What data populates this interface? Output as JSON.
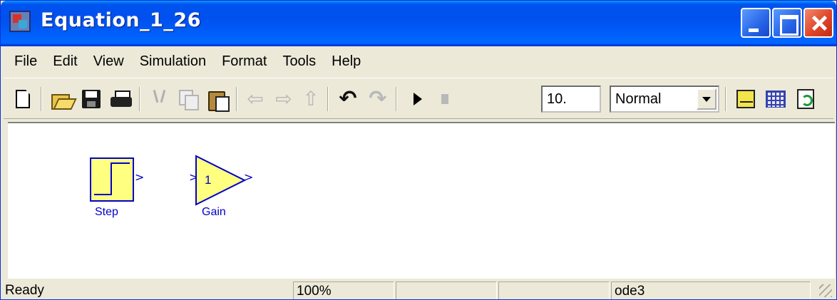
{
  "window": {
    "title": "Equation_1_26",
    "controls": [
      "minimize-icon",
      "maximize-icon",
      "close-icon"
    ]
  },
  "menu": {
    "items": [
      "File",
      "Edit",
      "View",
      "Simulation",
      "Format",
      "Tools",
      "Help"
    ]
  },
  "toolbar": {
    "icons": [
      "new-model-icon",
      "open-icon",
      "save-icon",
      "print-icon",
      "cut-icon",
      "copy-icon",
      "paste-icon",
      "back-icon",
      "forward-icon",
      "up-icon",
      "undo-icon",
      "redo-icon",
      "start-simulation-icon",
      "stop-simulation-icon",
      "library-browser-icon",
      "model-browser-icon",
      "update-diagram-icon"
    ],
    "stop_time": "10.",
    "simulation_mode": "Normal"
  },
  "blocks": [
    {
      "name": "Step",
      "icon": "step-block-icon"
    },
    {
      "name": "Gain",
      "icon": "gain-block-icon",
      "value": "1"
    }
  ],
  "status": {
    "state": "Ready",
    "zoom": "100%",
    "field3": "",
    "field4": "",
    "solver": "ode3"
  },
  "colors": {
    "block_fill": "#ffff80",
    "block_outline": "#0000c8",
    "titlebar": "#0053ee"
  }
}
